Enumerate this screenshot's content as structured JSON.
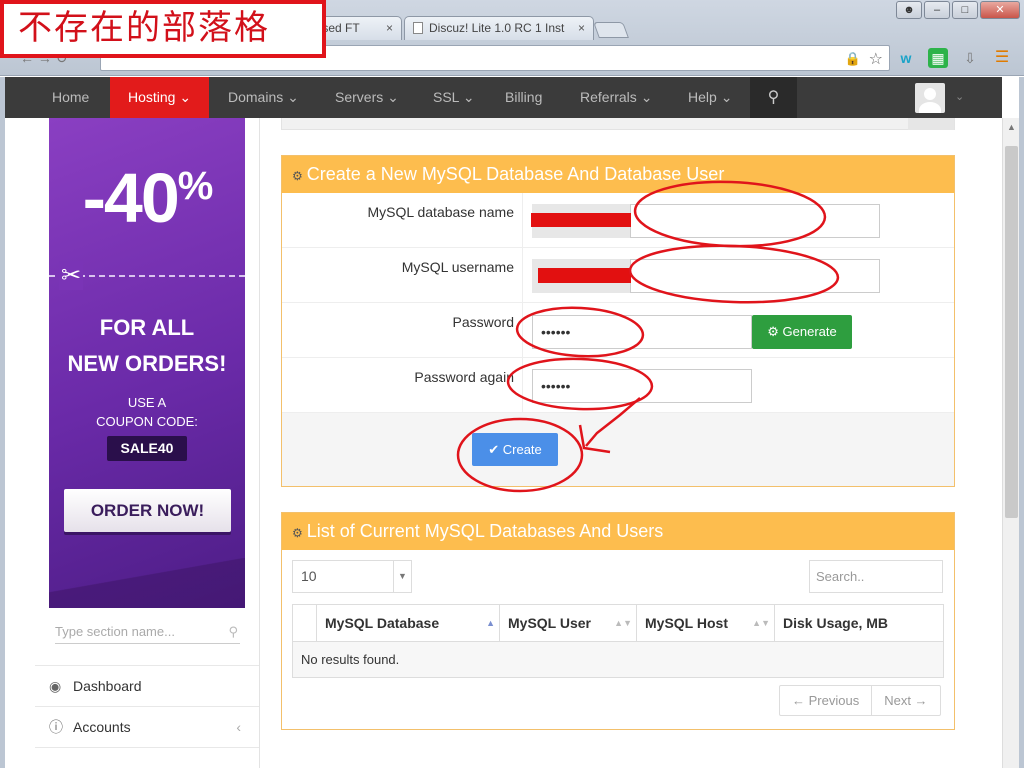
{
  "blog_label": "不存在的部落格",
  "browser": {
    "tabs": [
      {
        "title": "based FT"
      },
      {
        "title": "Discuz! Lite 1.0 RC 1 Inst"
      }
    ],
    "tab_close": "×",
    "url": "",
    "icons": [
      "lock-icon",
      "star-icon",
      "w-extension-icon",
      "grid-extension-icon",
      "download-icon",
      "menu-icon"
    ]
  },
  "nav": {
    "items": [
      {
        "label": "Home"
      },
      {
        "label": "Hosting"
      },
      {
        "label": "Domains"
      },
      {
        "label": "Servers"
      },
      {
        "label": "SSL"
      },
      {
        "label": "Billing"
      },
      {
        "label": "Referrals"
      },
      {
        "label": "Help"
      }
    ],
    "active": "Hosting"
  },
  "promo": {
    "discount": "-40",
    "percent": "%",
    "line1": "FOR ALL",
    "line2": "NEW ORDERS!",
    "use1": "USE A",
    "use2": "COUPON CODE:",
    "code": "SALE40",
    "cta": "ORDER NOW!"
  },
  "sidebar": {
    "search_placeholder": "Type section name...",
    "links": [
      {
        "label": "Dashboard"
      },
      {
        "label": "Accounts"
      }
    ]
  },
  "create_panel": {
    "title": "Create a New MySQL Database And Database User",
    "fields": [
      {
        "label": "MySQL database name",
        "value": ""
      },
      {
        "label": "MySQL username",
        "value": ""
      },
      {
        "label": "Password",
        "value": "••••••"
      },
      {
        "label": "Password again",
        "value": "••••••"
      }
    ],
    "generate_label": "Generate",
    "create_label": "Create"
  },
  "list_panel": {
    "title": "List of Current MySQL Databases And Users",
    "page_length": "10",
    "search_placeholder": "Search..",
    "columns": [
      "MySQL Database",
      "MySQL User",
      "MySQL Host",
      "Disk Usage, MB"
    ],
    "empty": "No results found.",
    "prev": "← Previous",
    "next": "Next →"
  },
  "colors": {
    "nav_active": "#e21b1b",
    "panel_header": "#fdbd4e",
    "generate": "#2e9e3f",
    "create": "#4b8fe8",
    "annotation": "#e0141b"
  }
}
